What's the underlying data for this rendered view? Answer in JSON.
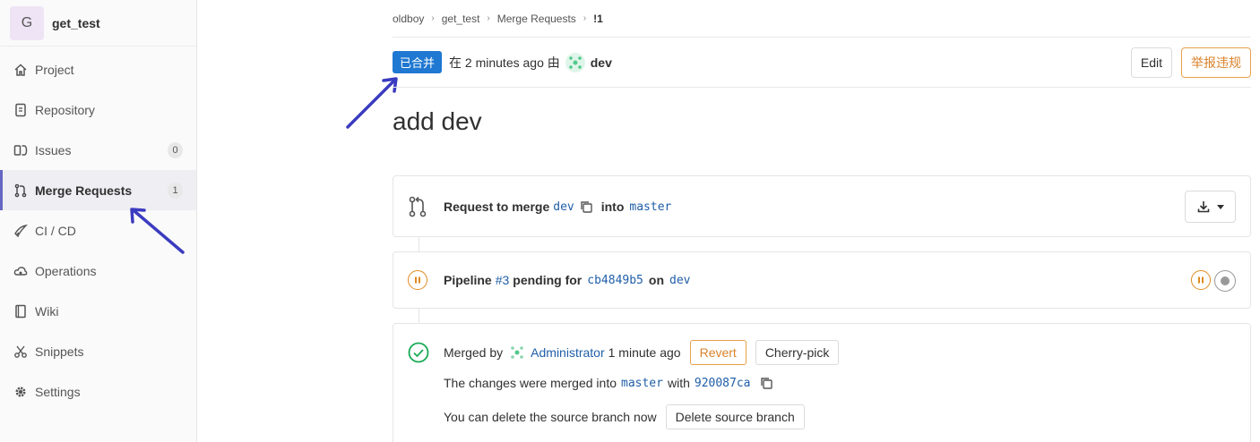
{
  "sidebar": {
    "project_initial": "G",
    "project_name": "get_test",
    "items": [
      {
        "label": "Project",
        "icon": "home-icon"
      },
      {
        "label": "Repository",
        "icon": "doc-icon"
      },
      {
        "label": "Issues",
        "icon": "issues-icon",
        "count": "0"
      },
      {
        "label": "Merge Requests",
        "icon": "merge-icon",
        "count": "1"
      },
      {
        "label": "CI / CD",
        "icon": "rocket-icon"
      },
      {
        "label": "Operations",
        "icon": "cloud-gear-icon"
      },
      {
        "label": "Wiki",
        "icon": "book-icon"
      },
      {
        "label": "Snippets",
        "icon": "scissors-icon"
      },
      {
        "label": "Settings",
        "icon": "gear-icon"
      }
    ]
  },
  "breadcrumb": [
    "oldboy",
    "get_test",
    "Merge Requests",
    "!1"
  ],
  "header": {
    "status": "已合并",
    "meta_prefix": "在 2 minutes ago 由",
    "author": "dev",
    "edit_label": "Edit",
    "report_label": "举报违规"
  },
  "title": "add dev",
  "request": {
    "text1": "Request to merge",
    "source": "dev",
    "text2": "into",
    "target": "master"
  },
  "pipeline": {
    "label": "Pipeline",
    "id": "#3",
    "status_text": "pending for",
    "commit": "cb4849b5",
    "on_text": "on",
    "branch": "dev"
  },
  "merged": {
    "label": "Merged by",
    "by": "Administrator",
    "when": "1 minute ago",
    "revert_label": "Revert",
    "cherry_label": "Cherry-pick",
    "changes_text": "The changes were merged into",
    "branch": "master",
    "with_text": "with",
    "commit": "920087ca",
    "delete_text": "You can delete the source branch now",
    "delete_label": "Delete source branch"
  },
  "colors": {
    "accent": "#1f78d1",
    "warning": "#e08a1e",
    "success": "#1aaa55",
    "annotation_arrow": "#3b3bc0"
  }
}
